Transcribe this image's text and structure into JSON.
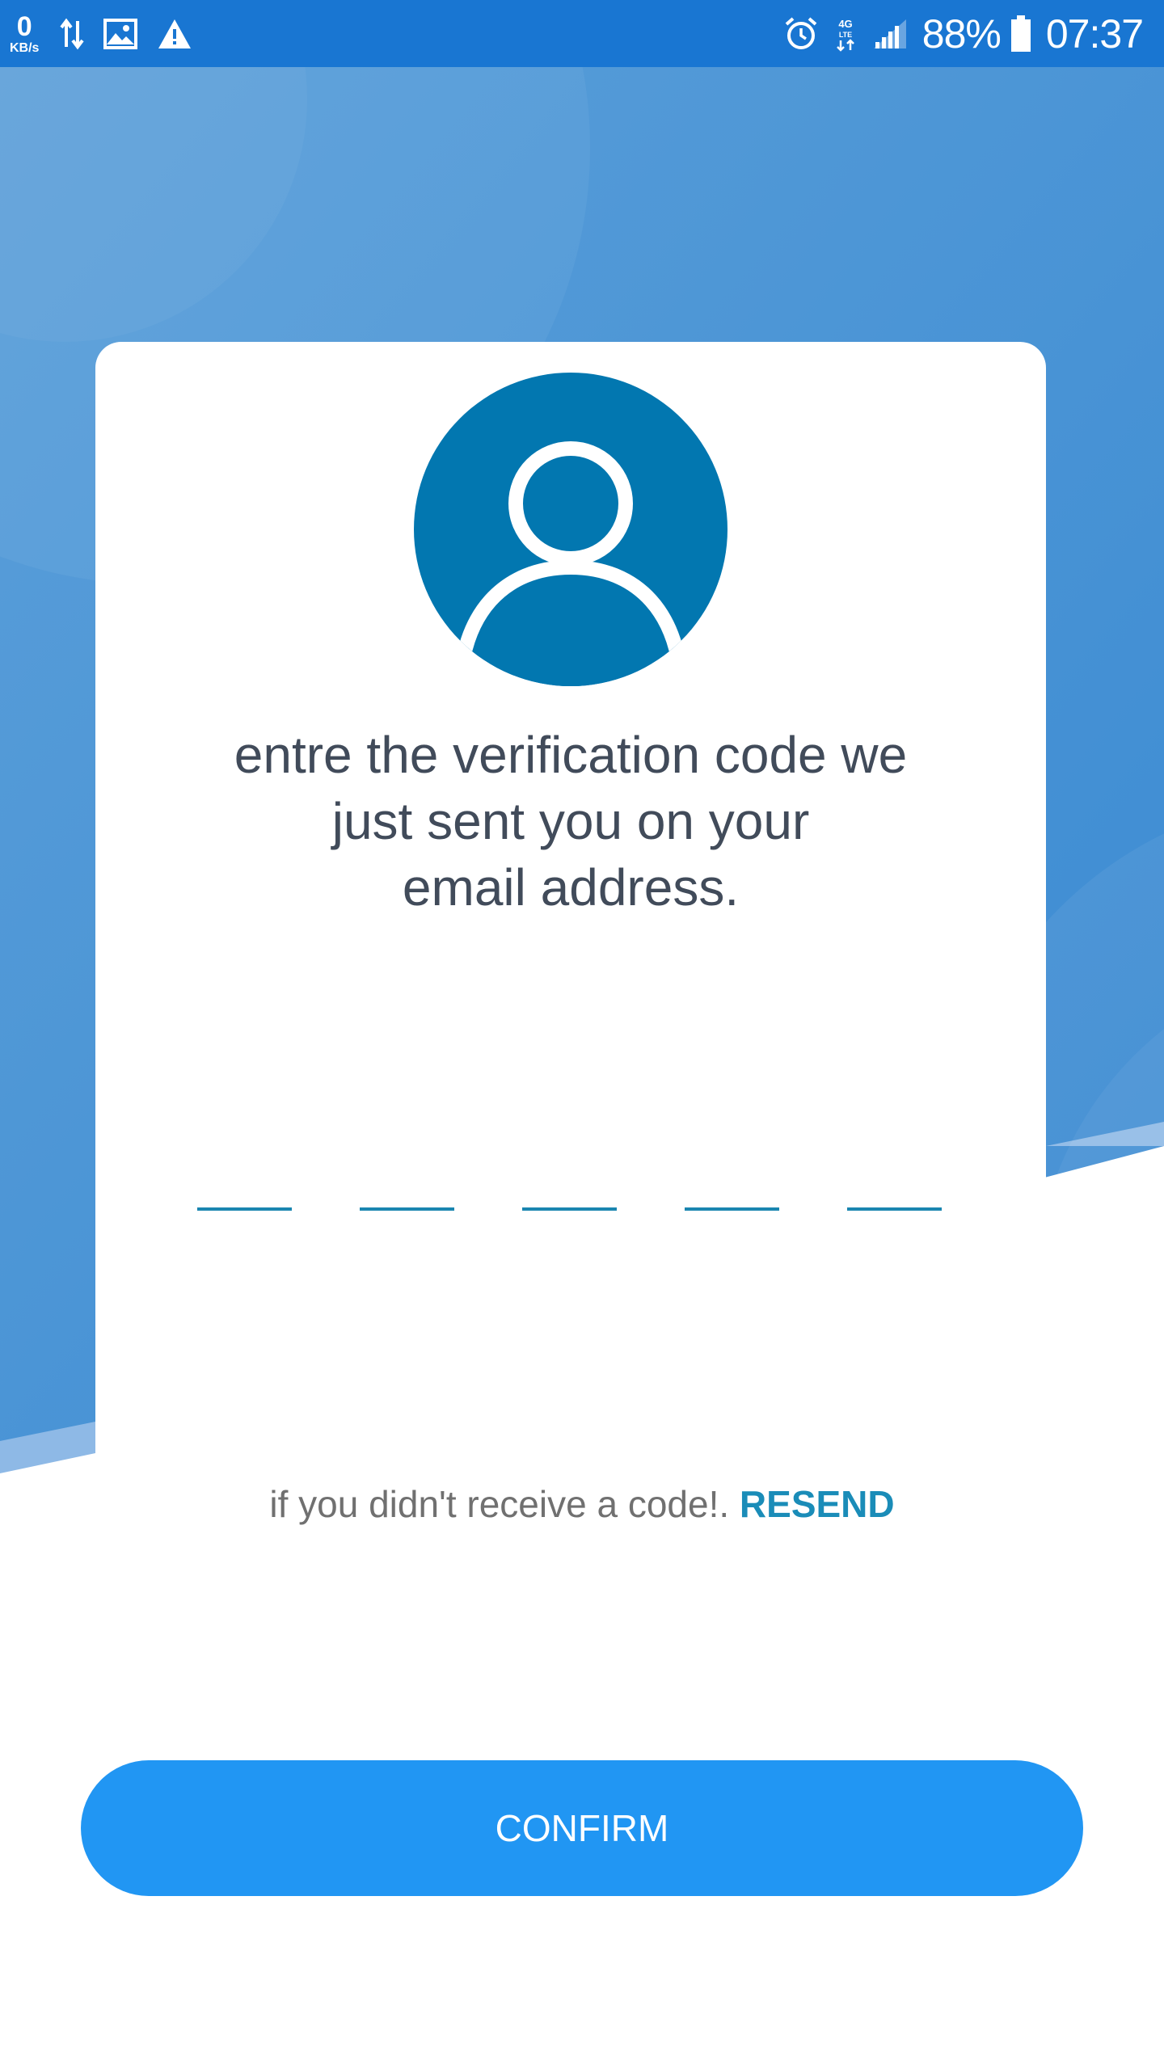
{
  "status_bar": {
    "speed_value": "0",
    "speed_unit": "KB/s",
    "battery": "88%",
    "time": "07:37",
    "network": "4G LTE",
    "left_icons": [
      "data-transfer-icon",
      "image-icon",
      "warning-icon"
    ],
    "right_icons": [
      "alarm-icon",
      "network-4g-icon",
      "signal-icon",
      "battery-icon"
    ]
  },
  "card": {
    "avatar_icon": "user-icon",
    "message": "entre the verification code we\njust sent you on your\nemail address.",
    "code_length": 5
  },
  "resend": {
    "text": "if you didn't receive a code!.",
    "link": "RESEND"
  },
  "confirm": {
    "label": "CONFIRM"
  },
  "colors": {
    "status_bar": "#1976d2",
    "background_blue": "#3f8fd6",
    "avatar_blue": "#0277b0",
    "accent": "#1a8cb8",
    "button": "#2196f3",
    "text": "#414b5a"
  }
}
